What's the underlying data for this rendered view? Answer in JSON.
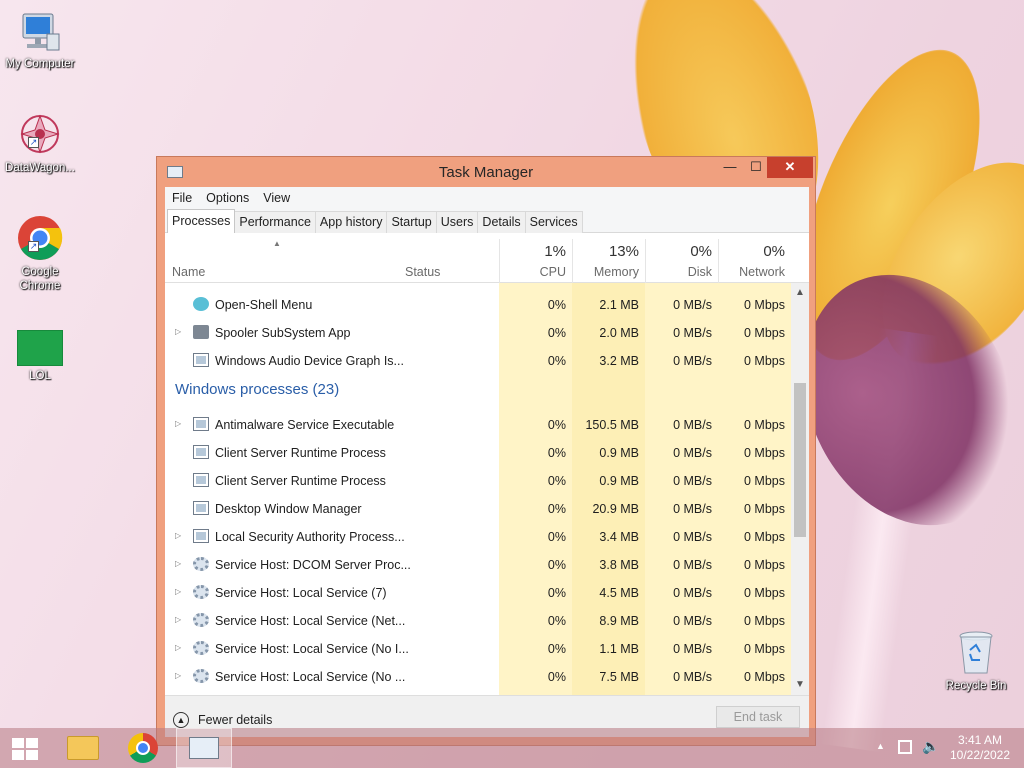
{
  "desktop": {
    "icons": [
      {
        "label": "My Computer"
      },
      {
        "label": "DataWagon..."
      },
      {
        "label": "Google Chrome"
      },
      {
        "label": "LOL"
      },
      {
        "label": "Recycle Bin"
      }
    ]
  },
  "window": {
    "title": "Task Manager",
    "controls": {
      "minimize": "—",
      "maximize": "☐",
      "close": "✕"
    }
  },
  "menu": {
    "file": "File",
    "options": "Options",
    "view": "View"
  },
  "tabs": [
    {
      "label": "Processes",
      "active": true
    },
    {
      "label": "Performance"
    },
    {
      "label": "App history"
    },
    {
      "label": "Startup"
    },
    {
      "label": "Users"
    },
    {
      "label": "Details"
    },
    {
      "label": "Services"
    }
  ],
  "columns": {
    "name": "Name",
    "status": "Status",
    "cpu": {
      "pct": "1%",
      "label": "CPU"
    },
    "memory": {
      "pct": "13%",
      "label": "Memory"
    },
    "disk": {
      "pct": "0%",
      "label": "Disk"
    },
    "network": {
      "pct": "0%",
      "label": "Network"
    }
  },
  "processes": [
    {
      "name": "Open-Shell Menu",
      "cpu": "0%",
      "memory": "2.1 MB",
      "disk": "0 MB/s",
      "network": "0 Mbps",
      "icon": "shell-icon",
      "expandable": false
    },
    {
      "name": "Spooler SubSystem App",
      "cpu": "0%",
      "memory": "2.0 MB",
      "disk": "0 MB/s",
      "network": "0 Mbps",
      "icon": "printer-icon",
      "expandable": true
    },
    {
      "name": "Windows Audio Device Graph Is...",
      "cpu": "0%",
      "memory": "3.2 MB",
      "disk": "0 MB/s",
      "network": "0 Mbps",
      "icon": "window-icon",
      "expandable": false
    }
  ],
  "windows_group": {
    "title": "Windows processes (23)",
    "rows": [
      {
        "name": "Antimalware Service Executable",
        "cpu": "0%",
        "memory": "150.5 MB",
        "disk": "0 MB/s",
        "network": "0 Mbps",
        "icon": "window-icon",
        "expandable": true
      },
      {
        "name": "Client Server Runtime Process",
        "cpu": "0%",
        "memory": "0.9 MB",
        "disk": "0 MB/s",
        "network": "0 Mbps",
        "icon": "window-icon",
        "expandable": false
      },
      {
        "name": "Client Server Runtime Process",
        "cpu": "0%",
        "memory": "0.9 MB",
        "disk": "0 MB/s",
        "network": "0 Mbps",
        "icon": "window-icon",
        "expandable": false
      },
      {
        "name": "Desktop Window Manager",
        "cpu": "0%",
        "memory": "20.9 MB",
        "disk": "0 MB/s",
        "network": "0 Mbps",
        "icon": "window-icon",
        "expandable": false
      },
      {
        "name": "Local Security Authority Process...",
        "cpu": "0%",
        "memory": "3.4 MB",
        "disk": "0 MB/s",
        "network": "0 Mbps",
        "icon": "window-icon",
        "expandable": true
      },
      {
        "name": "Service Host: DCOM Server Proc...",
        "cpu": "0%",
        "memory": "3.8 MB",
        "disk": "0 MB/s",
        "network": "0 Mbps",
        "icon": "gear-icon",
        "expandable": true
      },
      {
        "name": "Service Host: Local Service (7)",
        "cpu": "0%",
        "memory": "4.5 MB",
        "disk": "0 MB/s",
        "network": "0 Mbps",
        "icon": "gear-icon",
        "expandable": true
      },
      {
        "name": "Service Host: Local Service (Net...",
        "cpu": "0%",
        "memory": "8.9 MB",
        "disk": "0 MB/s",
        "network": "0 Mbps",
        "icon": "gear-icon",
        "expandable": true
      },
      {
        "name": "Service Host: Local Service (No I...",
        "cpu": "0%",
        "memory": "1.1 MB",
        "disk": "0 MB/s",
        "network": "0 Mbps",
        "icon": "gear-icon",
        "expandable": true
      },
      {
        "name": "Service Host: Local Service (No ...",
        "cpu": "0%",
        "memory": "7.5 MB",
        "disk": "0 MB/s",
        "network": "0 Mbps",
        "icon": "gear-icon",
        "expandable": true
      }
    ]
  },
  "footer": {
    "fewer_details": "Fewer details",
    "end_task": "End task"
  },
  "taskbar": {
    "time": "3:41 AM",
    "date": "10/22/2022"
  },
  "colors": {
    "accent_window": "#f0a07f",
    "close": "#c7402d",
    "group_title": "#2a5ea8",
    "cpu_col": "#fff4c7",
    "mem_col": "#fdefb6"
  }
}
